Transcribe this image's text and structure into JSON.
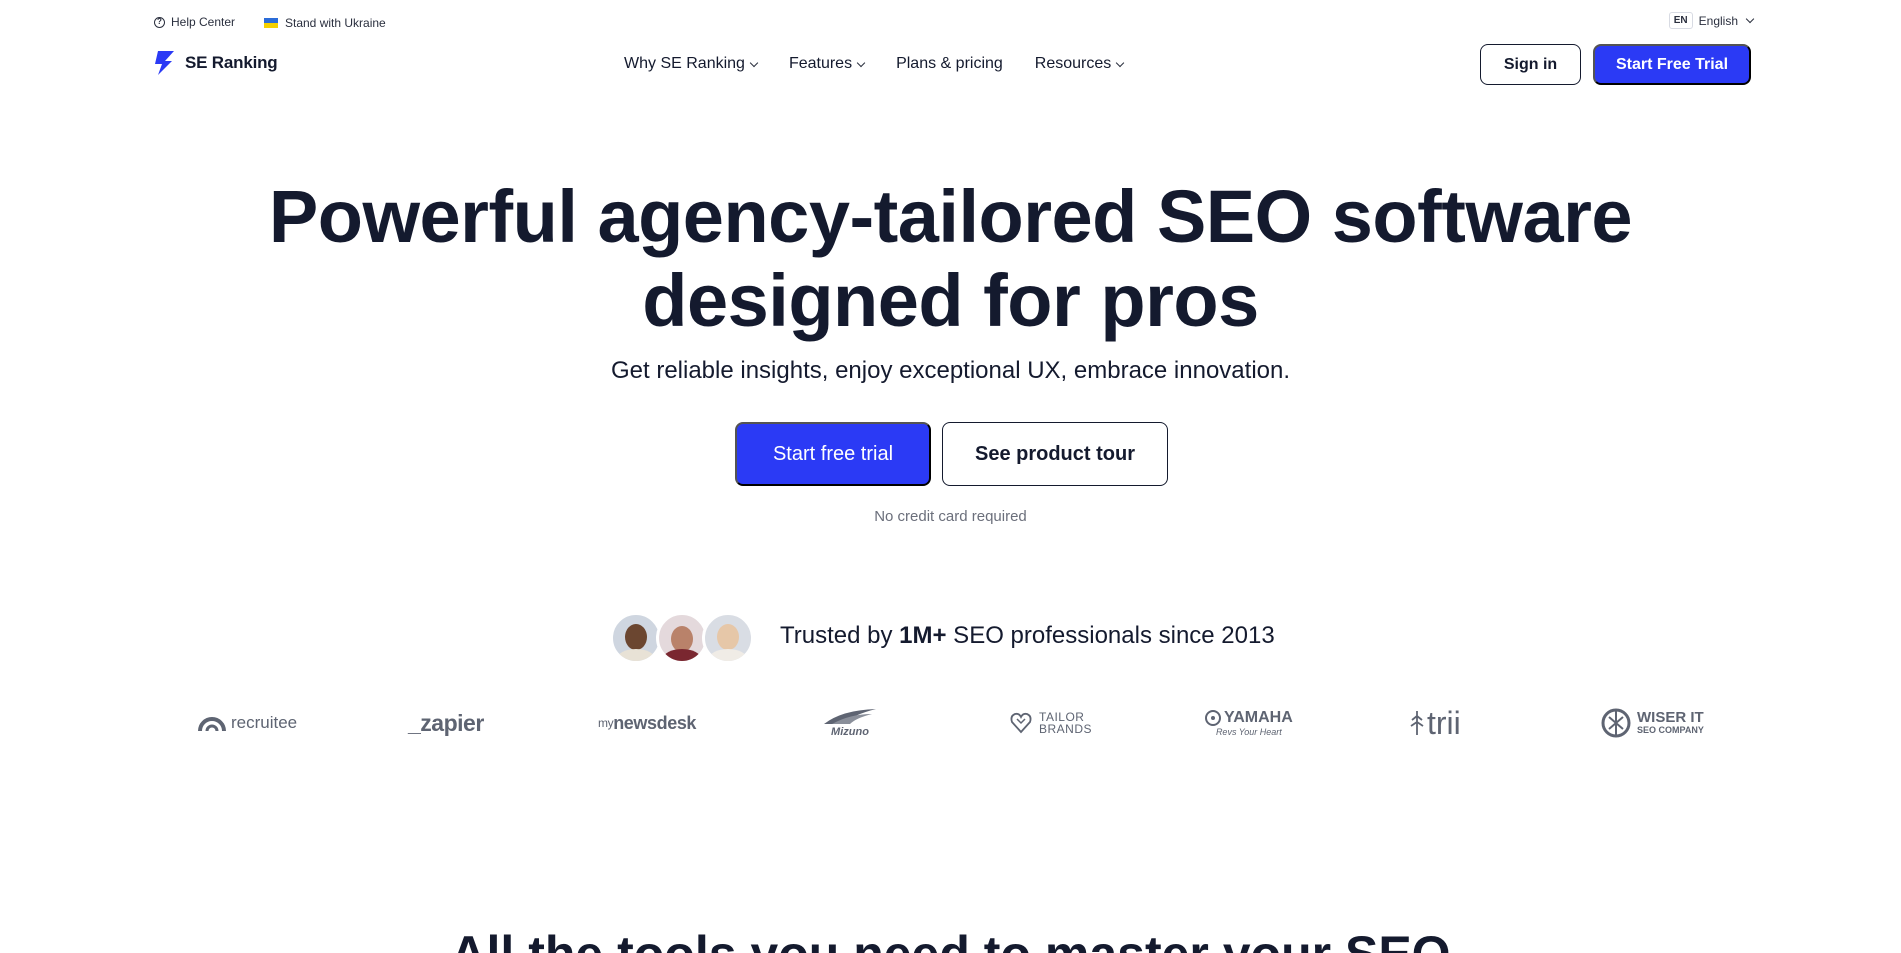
{
  "topbar": {
    "help_center": "Help Center",
    "ukraine": "Stand with Ukraine",
    "language_code": "EN",
    "language": "English"
  },
  "nav": {
    "brand": "SE Ranking",
    "menu": [
      {
        "label": "Why SE Ranking",
        "has_dropdown": true
      },
      {
        "label": "Features",
        "has_dropdown": true
      },
      {
        "label": "Plans & pricing",
        "has_dropdown": false
      },
      {
        "label": "Resources",
        "has_dropdown": true
      }
    ],
    "sign_in": "Sign in",
    "start_trial": "Start Free Trial"
  },
  "hero": {
    "title_line1": "Powerful agency-tailored SEO software",
    "title_line2": "designed for pros",
    "subtitle": "Get reliable insights, enjoy exceptional UX, embrace innovation.",
    "primary_cta": "Start free trial",
    "secondary_cta": "See product tour",
    "note": "No credit card required"
  },
  "trust": {
    "prefix": "Trusted by ",
    "highlight": "1M+",
    "suffix": " SEO professionals since 2013"
  },
  "logos": {
    "recruitee": "recruitee",
    "zapier": "_zapier",
    "newsdesk_prefix": "my",
    "newsdesk": "newsdesk",
    "mizuno": "Mizuno",
    "tailor_1": "TAILOR",
    "tailor_2": "BRANDS",
    "yamaha": "YAMAHA",
    "yamaha_tag": "Revs Your Heart",
    "trii": "trii",
    "wiser_1": "WISER IT",
    "wiser_2": "SEO COMPANY"
  },
  "next_section": {
    "title": "All the tools you need to master your SEO"
  },
  "colors": {
    "brand_blue": "#2b3af5",
    "text_dark": "#141a2e",
    "muted": "#6b6f7b"
  }
}
